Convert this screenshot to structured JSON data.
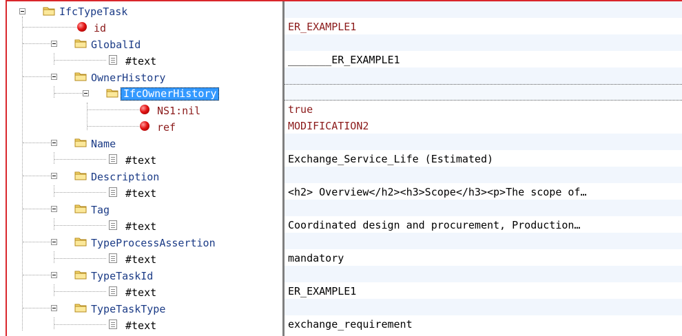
{
  "tree": {
    "root": {
      "label": "IfcTypeTask"
    },
    "id": {
      "label": "id"
    },
    "global_id": {
      "label": "GlobalId"
    },
    "global_id_text": {
      "label": "#text"
    },
    "owner_history": {
      "label": "OwnerHistory"
    },
    "ifc_owner_history": {
      "label": "IfcOwnerHistory"
    },
    "ns1_nil": {
      "label": "NS1:nil"
    },
    "ref": {
      "label": "ref"
    },
    "name": {
      "label": "Name"
    },
    "name_text": {
      "label": "#text"
    },
    "description": {
      "label": "Description"
    },
    "description_text": {
      "label": "#text"
    },
    "tag": {
      "label": "Tag"
    },
    "tag_text": {
      "label": "#text"
    },
    "type_process_assertion": {
      "label": "TypeProcessAssertion"
    },
    "type_process_assertion_text": {
      "label": "#text"
    },
    "type_task_id": {
      "label": "TypeTaskId"
    },
    "type_task_id_text": {
      "label": "#text"
    },
    "type_task_type": {
      "label": "TypeTaskType"
    },
    "type_task_type_text": {
      "label": "#text"
    }
  },
  "values": {
    "id": "ER_EXAMPLE1",
    "global_id_text": "_______ER_EXAMPLE1",
    "ns1_nil": "true",
    "ref": "MODIFICATION2",
    "name_text": "Exchange_Service_Life (Estimated)",
    "description_text": "<h2> Overview</h2><h3>Scope</h3><p>The scope of…",
    "tag_text": "Coordinated design and procurement, Production…",
    "type_process_assertion_text": "mandatory",
    "type_task_id_text": "ER_EXAMPLE1",
    "type_task_type_text": "exchange_requirement"
  },
  "colors": {
    "frame_border": "#d9262b",
    "element_label": "#1b3b86",
    "attribute_label": "#8b1a1a",
    "selection": "#3399ff",
    "alt_row": "#f1f6fd"
  },
  "icons": {
    "expander": "minus-box-icon",
    "element": "folder-icon",
    "attribute": "red-ball-icon",
    "text": "text-document-icon"
  }
}
